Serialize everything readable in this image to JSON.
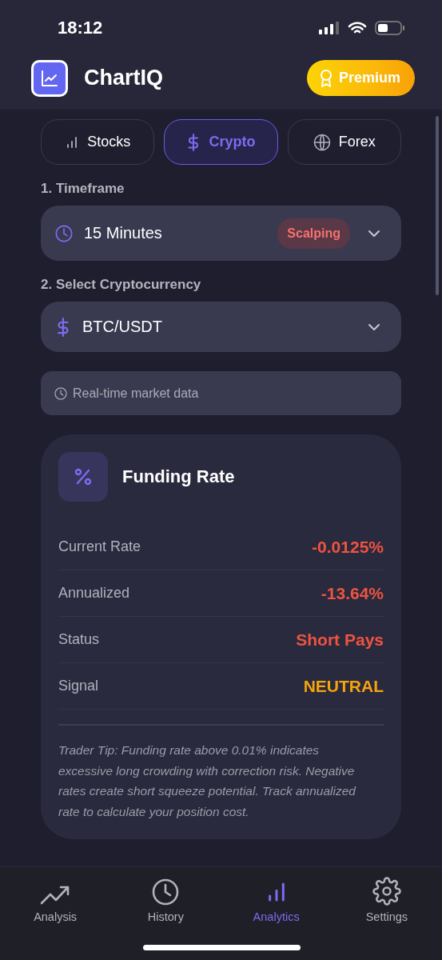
{
  "status_bar": {
    "time": "18:12"
  },
  "header": {
    "title": "ChartIQ",
    "premium_button": "Premium"
  },
  "market_tabs": [
    {
      "label": "Stocks",
      "kind": "bars",
      "selected": false
    },
    {
      "label": "Crypto",
      "kind": "dollar",
      "selected": true
    },
    {
      "label": "Forex",
      "kind": "globe",
      "selected": false
    }
  ],
  "timeframe": {
    "label": "1. Timeframe",
    "value": "15 Minutes",
    "badge": "Scalping"
  },
  "cryptocurrency": {
    "label": "2. Select Cryptocurrency",
    "value": "BTC/USDT"
  },
  "info_note": "Real-time market data",
  "funding_card": {
    "title": "Funding Rate",
    "rows": [
      {
        "label": "Current Rate",
        "value": "-0.0125%",
        "color": "#ef5340"
      },
      {
        "label": "Annualized",
        "value": "-13.64%",
        "color": "#ef5340"
      },
      {
        "label": "Status",
        "value": "Short Pays",
        "color": "#ef5340"
      },
      {
        "label": "Signal",
        "value": "NEUTRAL",
        "color": "#f5a40c"
      }
    ],
    "tip": "Trader Tip: Funding rate above 0.01% indicates excessive long crowding with correction risk. Negative rates create short squeeze potential. Track annualized rate to calculate your position cost."
  },
  "bottom_nav": [
    {
      "label": "Analysis",
      "kind": "trend",
      "selected": false
    },
    {
      "label": "History",
      "kind": "clock",
      "selected": false
    },
    {
      "label": "Analytics",
      "kind": "bars",
      "selected": true
    },
    {
      "label": "Settings",
      "kind": "gear",
      "selected": false
    }
  ]
}
